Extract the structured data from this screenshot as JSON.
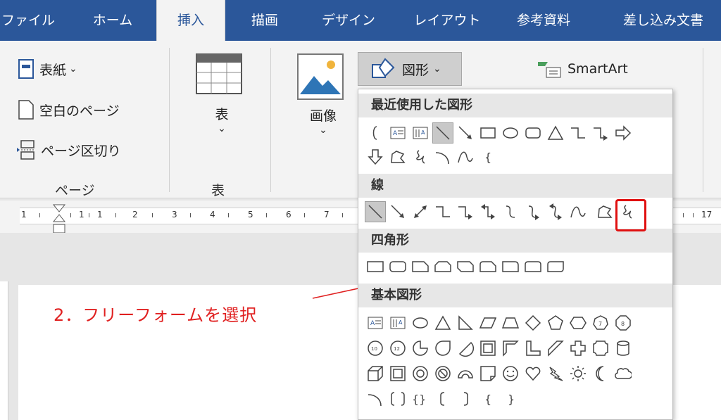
{
  "tabs": [
    {
      "label": "ファイル",
      "active": false
    },
    {
      "label": "ホーム",
      "active": false
    },
    {
      "label": "挿入",
      "active": true
    },
    {
      "label": "描画",
      "active": false
    },
    {
      "label": "デザイン",
      "active": false
    },
    {
      "label": "レイアウト",
      "active": false
    },
    {
      "label": "参考資料",
      "active": false
    },
    {
      "label": "差し込み文書",
      "active": false
    }
  ],
  "ribbon": {
    "cover_label": "表紙",
    "blank_page_label": "空白のページ",
    "page_break_label": "ページ区切り",
    "group_page_label": "ページ",
    "table_label": "表",
    "group_table_label": "表",
    "image_label": "画像",
    "shapes_label": "図形",
    "smartart_label": "SmartArt",
    "dropdown_caret": "⌄"
  },
  "dropdown": {
    "recent_header": "最近使用した図形",
    "lines_header": "線",
    "rect_header": "四角形",
    "basic_header": "基本図形"
  },
  "ruler": {
    "numbers": [
      "1",
      "1",
      "1",
      "2",
      "3",
      "4",
      "5",
      "6",
      "7",
      "17"
    ]
  },
  "annotation": {
    "text": "2．フリーフォームを選択",
    "color": "#e02020"
  },
  "colors": {
    "tab_bar": "#2b579a",
    "highlight": "#e01010"
  }
}
